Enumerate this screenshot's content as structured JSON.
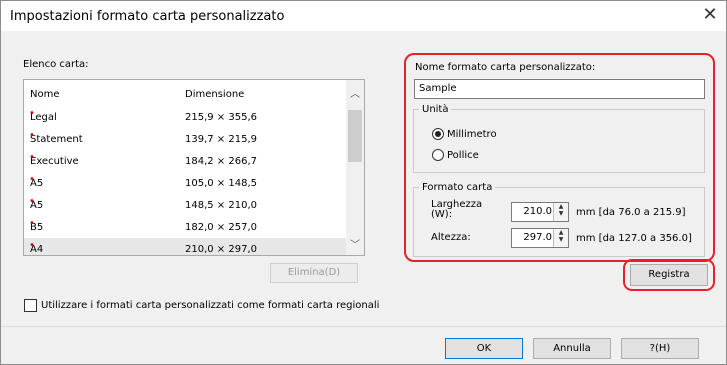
{
  "window": {
    "title": "Impostazioni formato carta personalizzato"
  },
  "icons": {
    "close": "close-icon"
  },
  "list": {
    "label": "Elenco carta:",
    "columns": [
      "Nome",
      "Dimensione"
    ],
    "rows": [
      {
        "name": "Legal",
        "dim": "215,9 × 355,6"
      },
      {
        "name": "Statement",
        "dim": "139,7 × 215,9"
      },
      {
        "name": "Executive",
        "dim": "184,2 × 266,7"
      },
      {
        "name": "A5",
        "dim": "105,0 × 148,5"
      },
      {
        "name": "A5",
        "dim": "148,5 × 210,0"
      },
      {
        "name": "B5",
        "dim": "182,0 × 257,0"
      },
      {
        "name": "A4",
        "dim": "210,0 × 297,0"
      }
    ],
    "selected_index": 6
  },
  "buttons": {
    "delete": "Elimina(D)",
    "register": "Registra",
    "ok": "OK",
    "cancel": "Annulla",
    "help": "?(H)"
  },
  "right": {
    "name_label": "Nome formato carta personalizzato:",
    "name_value": "Sample",
    "units_title": "Unità",
    "unit_mm": "Millimetro",
    "unit_inch": "Pollice",
    "selected_unit": "Millimetro",
    "size_title": "Formato carta",
    "width_label": "Larghezza (W):",
    "width_value": "210.0",
    "width_range": "mm [da 76.0 a 215.9]",
    "height_label": "Altezza:",
    "height_value": "297.0",
    "height_range": "mm [da 127.0 a 356.0]"
  },
  "checkbox": {
    "label": "Utilizzare i formati carta personalizzati come formati carta regionali",
    "checked": false
  },
  "highlight_color": "#e8202a"
}
